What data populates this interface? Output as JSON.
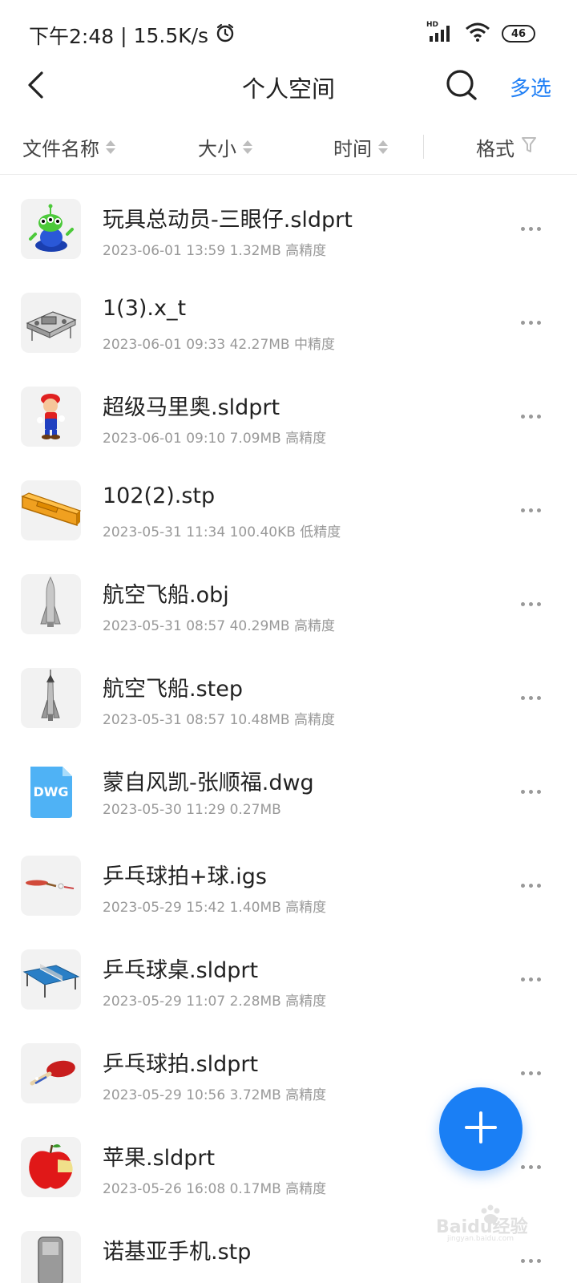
{
  "status_bar": {
    "time": "下午2:48",
    "net_speed": "15.5K/s",
    "battery": "46",
    "network_badge": "HD",
    "icons": [
      "alarm-icon",
      "signal-icon",
      "wifi-icon",
      "battery-icon"
    ]
  },
  "header": {
    "title": "个人空间",
    "multi_select": "多选",
    "icons": [
      "back-arrow-icon",
      "search-icon"
    ]
  },
  "sort_bar": {
    "name": "文件名称",
    "size": "大小",
    "time": "时间",
    "format": "格式",
    "icons": [
      "sort-arrows-icon",
      "filter-icon"
    ]
  },
  "files": [
    {
      "name": "玩具总动员-三眼仔.sldprt",
      "meta": "2023-06-01 13:59 1.32MB 高精度",
      "thumb": "alien-model-thumbnail"
    },
    {
      "name": "1(3).x_t",
      "meta": "2023-06-01 09:33 42.27MB 中精度",
      "thumb": "machine-model-thumbnail"
    },
    {
      "name": "超级马里奥.sldprt",
      "meta": "2023-06-01 09:10 7.09MB 高精度",
      "thumb": "mario-model-thumbnail"
    },
    {
      "name": "102(2).stp",
      "meta": "2023-05-31 11:34 100.40KB 低精度",
      "thumb": "orange-part-thumbnail"
    },
    {
      "name": "航空飞船.obj",
      "meta": "2023-05-31 08:57 40.29MB 高精度",
      "thumb": "rocket-thumbnail"
    },
    {
      "name": "航空飞船.step",
      "meta": "2023-05-31 08:57 10.48MB 高精度",
      "thumb": "rocket-thumbnail"
    },
    {
      "name": "蒙自风凯-张顺福.dwg",
      "meta": "2023-05-30 11:29 0.27MB",
      "thumb": "dwg-file-icon",
      "thumb_label": "DWG"
    },
    {
      "name": "乒乓球拍+球.igs",
      "meta": "2023-05-29 15:42 1.40MB 高精度",
      "thumb": "paddle-ball-thumbnail"
    },
    {
      "name": "乒乓球桌.sldprt",
      "meta": "2023-05-29 11:07 2.28MB 高精度",
      "thumb": "pingpong-table-thumbnail"
    },
    {
      "name": "乒乓球拍.sldprt",
      "meta": "2023-05-29 10:56 3.72MB 高精度",
      "thumb": "paddle-thumbnail"
    },
    {
      "name": "苹果.sldprt",
      "meta": "2023-05-26 16:08 0.17MB 高精度",
      "thumb": "apple-thumbnail"
    },
    {
      "name": "诺基亚手机.stp",
      "meta": "",
      "thumb": "phone-thumbnail"
    }
  ],
  "fab": {
    "icon": "plus-icon"
  },
  "watermark": {
    "text": "Baidu经验",
    "sub": "jingyan.baidu.com"
  },
  "colors": {
    "accent": "#1f7ff5",
    "fab": "#1a7ff5",
    "meta_text": "#999999",
    "divider": "#ececec"
  }
}
